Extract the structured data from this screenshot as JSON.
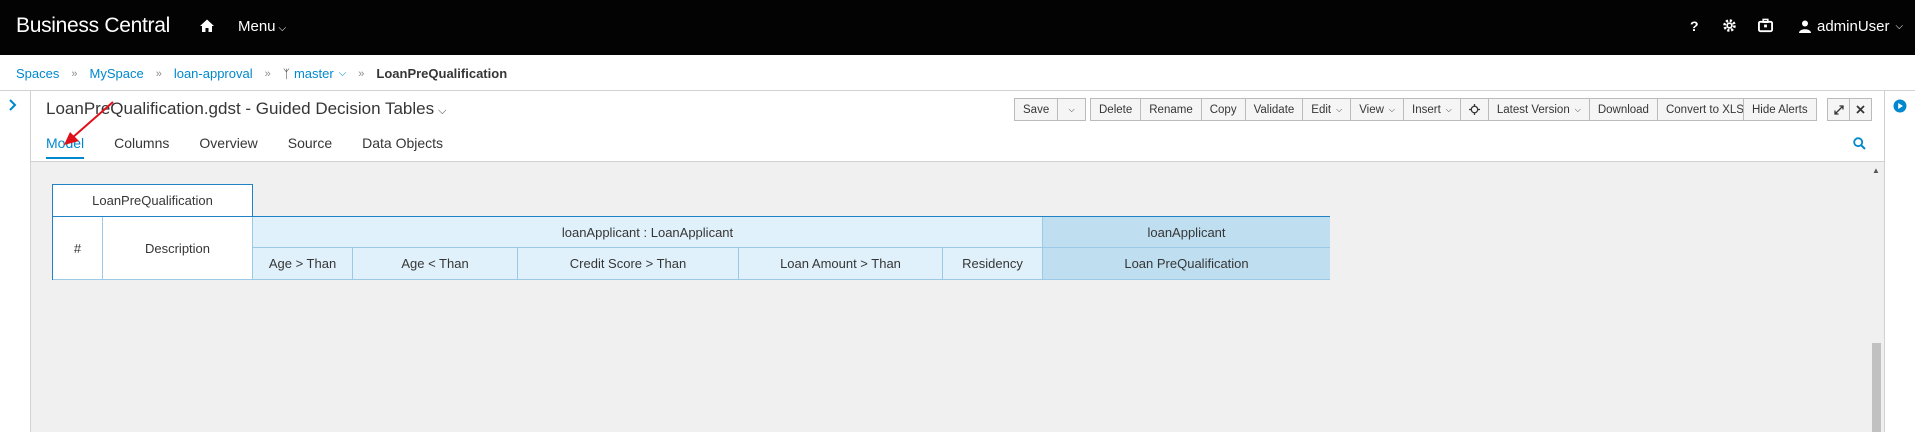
{
  "topbar": {
    "brand": "Business Central",
    "menu_label": "Menu",
    "help_label": "?",
    "user_label": "adminUser"
  },
  "breadcrumb": {
    "items": [
      "Spaces",
      "MySpace",
      "loan-approval",
      "master"
    ],
    "current": "LoanPreQualification"
  },
  "editor": {
    "title": "LoanPreQualification.gdst - Guided Decision Tables",
    "toolbar": {
      "save": "Save",
      "delete": "Delete",
      "rename": "Rename",
      "copy": "Copy",
      "validate": "Validate",
      "edit": "Edit",
      "view": "View",
      "insert": "Insert",
      "latest_version": "Latest Version",
      "download": "Download",
      "convert": "Convert to XLS",
      "hide_alerts": "Hide Alerts"
    },
    "tabs": [
      "Model",
      "Columns",
      "Overview",
      "Source",
      "Data Objects"
    ],
    "active_tab": "Model"
  },
  "decision_table": {
    "name": "LoanPreQualification",
    "row_number_header": "#",
    "description_header": "Description",
    "condition_group": "loanApplicant : LoanApplicant",
    "action_group": "loanApplicant",
    "conditions": [
      "Age > Than",
      "Age < Than",
      "Credit Score > Than",
      "Loan Amount > Than",
      "Residency"
    ],
    "action": "Loan PreQualification"
  },
  "colors": {
    "topbar_bg": "#030303",
    "link": "#0088ce",
    "table_border": "#1f83c6",
    "condition_bg": "#e0f1fb",
    "action_bg": "#bfdff1",
    "annotation": "#e0101a"
  }
}
